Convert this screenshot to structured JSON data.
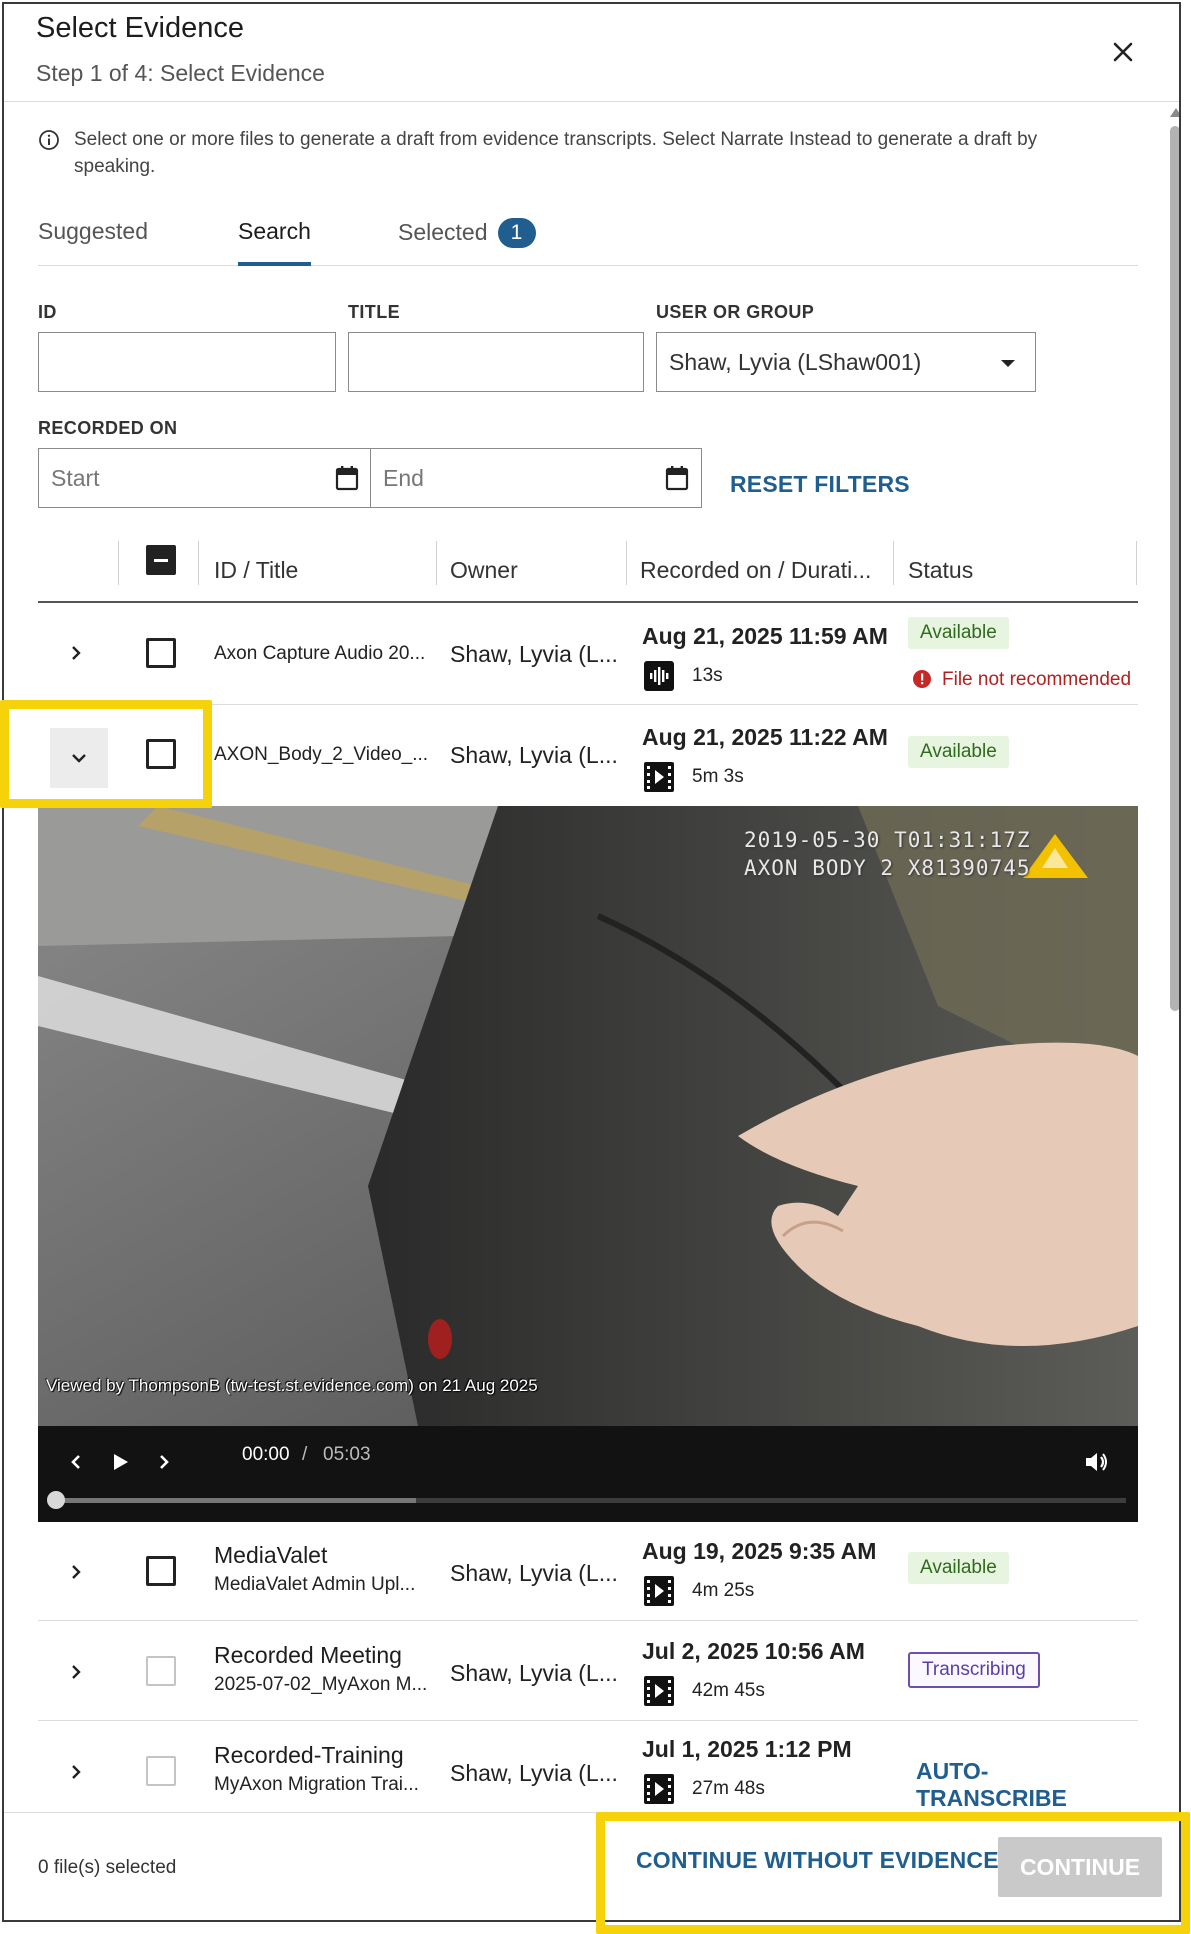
{
  "dialog": {
    "title": "Select Evidence",
    "subtitle": "Step 1 of 4: Select Evidence",
    "close_icon": "close-icon"
  },
  "info": {
    "text": "Select one or more files to generate a draft from evidence transcripts. Select Narrate Instead to generate a draft by speaking.",
    "icon": "info-icon"
  },
  "tabs": [
    {
      "label": "Suggested",
      "active": false
    },
    {
      "label": "Search",
      "active": true
    },
    {
      "label": "Selected",
      "active": false,
      "badge": "1"
    }
  ],
  "filters": {
    "id_label": "ID",
    "id_value": "",
    "title_label": "TITLE",
    "title_value": "",
    "user_label": "USER OR GROUP",
    "user_value": "Shaw, Lyvia (LShaw001)",
    "recorded_label": "RECORDED ON",
    "start_placeholder": "Start",
    "end_placeholder": "End",
    "reset_label": "RESET FILTERS"
  },
  "table": {
    "headers": [
      "ID / Title",
      "Owner",
      "Recorded on / Durati...",
      "Status"
    ],
    "rows": [
      {
        "id": "Axon Capture Audio 20...",
        "title": "",
        "owner": "Shaw, Lyvia (L...",
        "date": "Aug 21, 2025 11:59 AM",
        "duration": "13s",
        "media": "audio-icon",
        "status": "Available",
        "warning": "File not recommended",
        "expanded": false
      },
      {
        "id": "AXON_Body_2_Video_...",
        "title": "",
        "owner": "Shaw, Lyvia (L...",
        "date": "Aug 21, 2025 11:22 AM",
        "duration": "5m 3s",
        "media": "video-icon",
        "status": "Available",
        "expanded": true
      },
      {
        "id": "MediaValet Admin Upl...",
        "title": "MediaValet",
        "owner": "Shaw, Lyvia (L...",
        "date": "Aug 19, 2025 9:35 AM",
        "duration": "4m 25s",
        "media": "video-icon",
        "status": "Available"
      },
      {
        "id": "2025-07-02_MyAxon M...",
        "title": "Recorded Meeting",
        "owner": "Shaw, Lyvia (L...",
        "date": "Jul 2, 2025 10:56 AM",
        "duration": "42m 45s",
        "media": "video-icon",
        "status": "Transcribing"
      },
      {
        "id": "MyAxon Migration Trai...",
        "title": "Recorded-Training",
        "owner": "Shaw, Lyvia (L...",
        "date": "Jul 1, 2025 1:12 PM",
        "duration": "27m 48s",
        "media": "video-icon",
        "status": "AUTO-TRANSCRIBE"
      }
    ]
  },
  "video": {
    "stamp_line1": "2019-05-30 T01:31:17Z",
    "stamp_line2": "AXON BODY 2 X81390745",
    "watermark": "Viewed by ThompsonB (tw-test.st.evidence.com) on 21 Aug 2025",
    "current_time": "00:00",
    "separator": "/",
    "total_time": "05:03",
    "buffered_fraction": 0.34,
    "played_fraction": 0.0
  },
  "footer": {
    "selected_count": "0 file(s) selected",
    "continue_without": "CONTINUE WITHOUT EVIDENCE",
    "continue": "CONTINUE"
  },
  "colors": {
    "accent": "#1f5e8f",
    "available_bg": "#e7f4df",
    "available_text": "#2f6b1e",
    "transcribing": "#6c4fb3",
    "warning": "#b22020",
    "highlight": "#f5d20a",
    "disabled_button": "#c9c9c9"
  }
}
